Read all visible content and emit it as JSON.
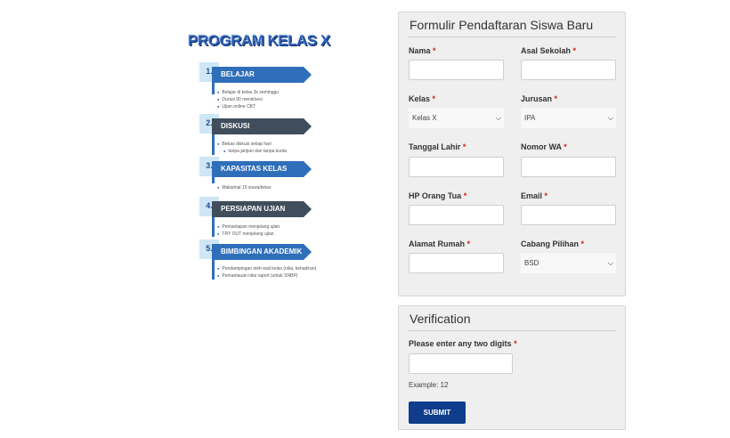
{
  "infographic": {
    "title": "PROGRAM KELAS X",
    "steps": [
      {
        "num": "1.",
        "label": "BELAJAR",
        "color": "#2f6fba",
        "bullets": [
          "Belajar di kelas 3x seminggu",
          "Durasi 90 menit/sesi",
          "Ujian online CBT"
        ]
      },
      {
        "num": "2.",
        "label": "DISKUSI",
        "color": "#3f4d5c",
        "bullets": [
          "Bebas diskusi setiap hari",
          "tanpa janjian dan tanpa kuota"
        ]
      },
      {
        "num": "3.",
        "label": "KAPASITAS KELAS",
        "color": "#2f6fba",
        "bullets": [
          "Maksimal 15 siswa/kelas"
        ]
      },
      {
        "num": "4.",
        "label": "PERSIAPAN UJIAN",
        "color": "#3f4d5c",
        "bullets": [
          "Pemantapan menjelang ujian",
          "TRY OUT menjelang ujian"
        ]
      },
      {
        "num": "5.",
        "label": "BIMBINGAN AKADEMIK",
        "color": "#2f6fba",
        "bullets": [
          "Pendampingan oleh wali kelas (nilai, kehadiran)",
          "Pemantauan nilai raport (untuk SNBP)"
        ]
      }
    ]
  },
  "registration_form": {
    "title": "Formulir Pendaftaran Siswa Baru",
    "required_mark": "*",
    "fields": {
      "nama": {
        "label": "Nama",
        "value": ""
      },
      "asal_sekolah": {
        "label": "Asal Sekolah",
        "value": ""
      },
      "kelas": {
        "label": "Kelas",
        "selected": "Kelas X"
      },
      "jurusan": {
        "label": "Jurusan",
        "selected": "IPA"
      },
      "tanggal_lahir": {
        "label": "Tanggal Lahir",
        "value": ""
      },
      "nomor_wa": {
        "label": "Nomor WA",
        "value": ""
      },
      "hp_orang_tua": {
        "label": "HP Orang Tua",
        "value": ""
      },
      "email": {
        "label": "Email",
        "value": ""
      },
      "alamat_rumah": {
        "label": "Alamat Rumah",
        "value": ""
      },
      "cabang_pilihan": {
        "label": "Cabang Pilihan",
        "selected": "BSD"
      }
    }
  },
  "verification": {
    "title": "Verification",
    "label": "Please enter any two digits",
    "required_mark": "*",
    "value": "",
    "hint": "Example: 12",
    "submit_label": "SUBMIT"
  },
  "colors": {
    "accent": "#0f3d8c",
    "required": "#d02020",
    "card_bg": "#efefef"
  },
  "icons": {
    "select_arrow": "chevron-down-icon"
  }
}
